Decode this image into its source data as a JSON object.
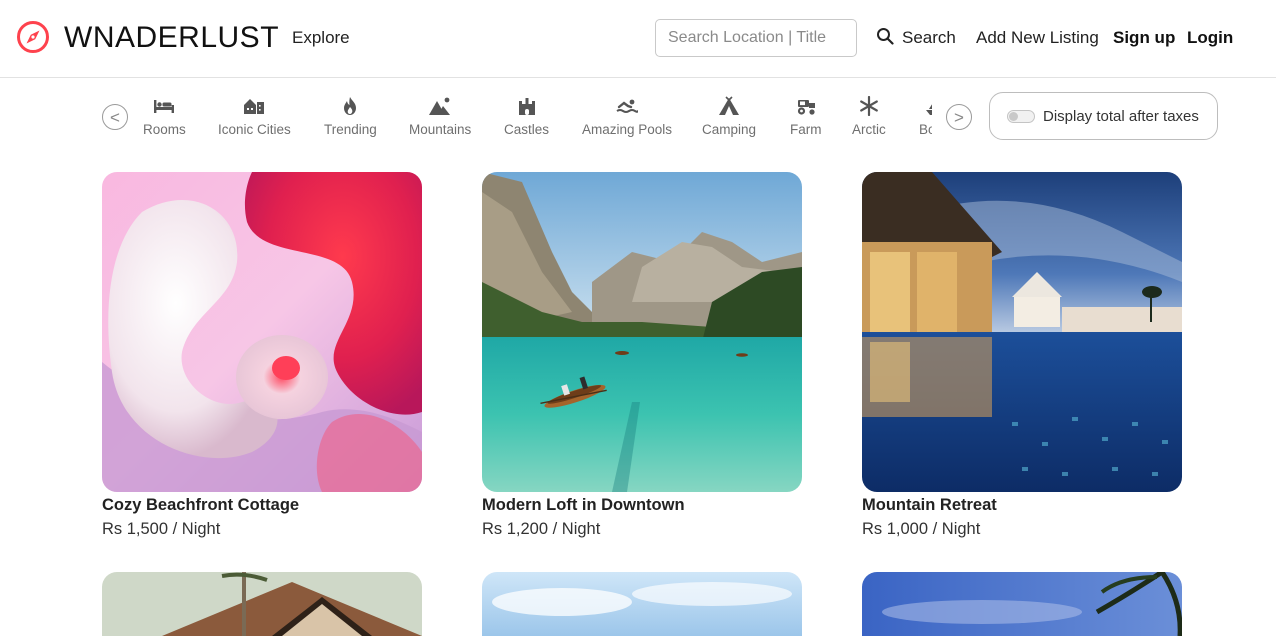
{
  "brand": {
    "name": "WNADERLUST",
    "accent_color": "#fe424d",
    "icon": "compass-icon"
  },
  "nav": {
    "explore": "Explore",
    "search_placeholder": "Search Location | Title",
    "search_label": "Search",
    "add_listing": "Add New Listing",
    "signup": "Sign up",
    "login": "Login"
  },
  "filters": {
    "prev_symbol": "<",
    "next_symbol": ">",
    "items": [
      {
        "label": "Rooms",
        "icon": "bed-icon"
      },
      {
        "label": "Iconic Cities",
        "icon": "city-icon"
      },
      {
        "label": "Trending",
        "icon": "fire-icon"
      },
      {
        "label": "Mountains",
        "icon": "mountain-icon"
      },
      {
        "label": "Castles",
        "icon": "castle-icon"
      },
      {
        "label": "Amazing Pools",
        "icon": "swimmer-icon"
      },
      {
        "label": "Camping",
        "icon": "tent-icon"
      },
      {
        "label": "Farm",
        "icon": "tractor-icon"
      },
      {
        "label": "Arctic",
        "icon": "snowflake-icon"
      },
      {
        "label": "Boats",
        "icon": "boat-icon"
      }
    ],
    "tax_toggle_label": "Display total after taxes",
    "tax_toggle_on": false
  },
  "listings": [
    {
      "title": "Cozy Beachfront Cottage",
      "price": "Rs 1,500 / Night"
    },
    {
      "title": "Modern Loft in Downtown",
      "price": "Rs 1,200 / Night"
    },
    {
      "title": "Mountain Retreat",
      "price": "Rs 1,000 / Night"
    },
    {
      "title": "",
      "price": ""
    },
    {
      "title": "",
      "price": ""
    },
    {
      "title": "",
      "price": ""
    }
  ]
}
